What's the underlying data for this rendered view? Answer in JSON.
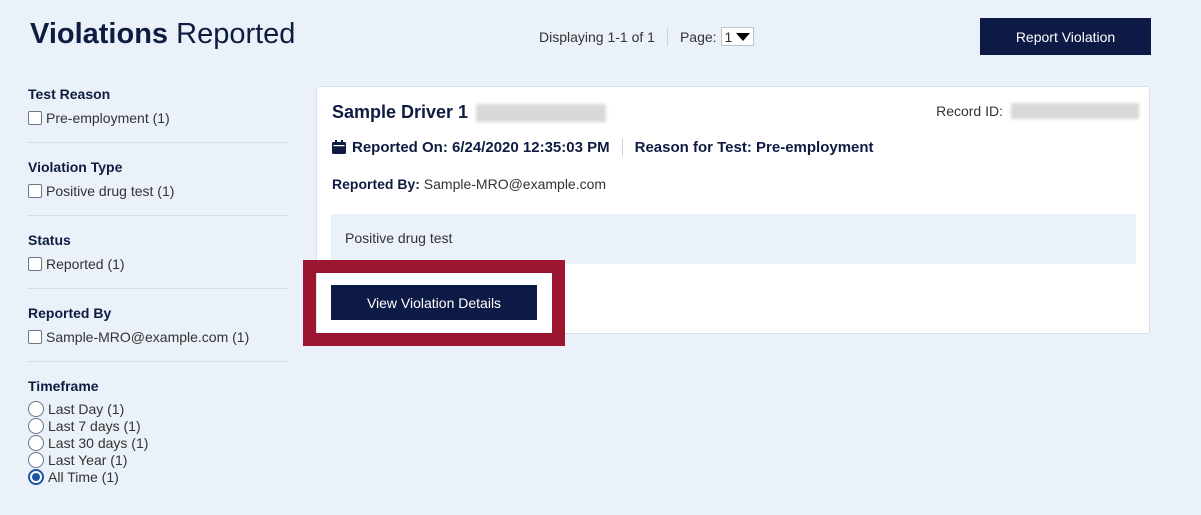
{
  "header": {
    "title_bold": "Violations",
    "title_light": "Reported",
    "displaying": "Displaying 1-1 of 1",
    "page_label": "Page:",
    "page_value": "1",
    "report_button": "Report Violation"
  },
  "filters": {
    "test_reason": {
      "title": "Test Reason",
      "options": [
        "Pre-employment (1)"
      ]
    },
    "violation_type": {
      "title": "Violation Type",
      "options": [
        "Positive drug test (1)"
      ]
    },
    "status": {
      "title": "Status",
      "options": [
        "Reported (1)"
      ]
    },
    "reported_by": {
      "title": "Reported By",
      "options": [
        "Sample-MRO@example.com (1)"
      ]
    },
    "timeframe": {
      "title": "Timeframe",
      "options": [
        "Last Day (1)",
        "Last 7 days (1)",
        "Last 30 days (1)",
        "Last Year (1)",
        "All Time (1)"
      ],
      "selected": "All Time (1)"
    }
  },
  "record": {
    "driver_name": "Sample Driver 1",
    "record_id_label": "Record ID:",
    "reported_on": "Reported On: 6/24/2020 12:35:03 PM",
    "reason": "Reason for Test: Pre-employment",
    "reported_by_label": "Reported By:",
    "reported_by_value": "Sample-MRO@example.com",
    "description": "Positive drug test",
    "details_button": "View Violation Details"
  },
  "colors": {
    "navy": "#0c1a45",
    "highlight": "#9c1632",
    "background": "#eaf1f9"
  }
}
